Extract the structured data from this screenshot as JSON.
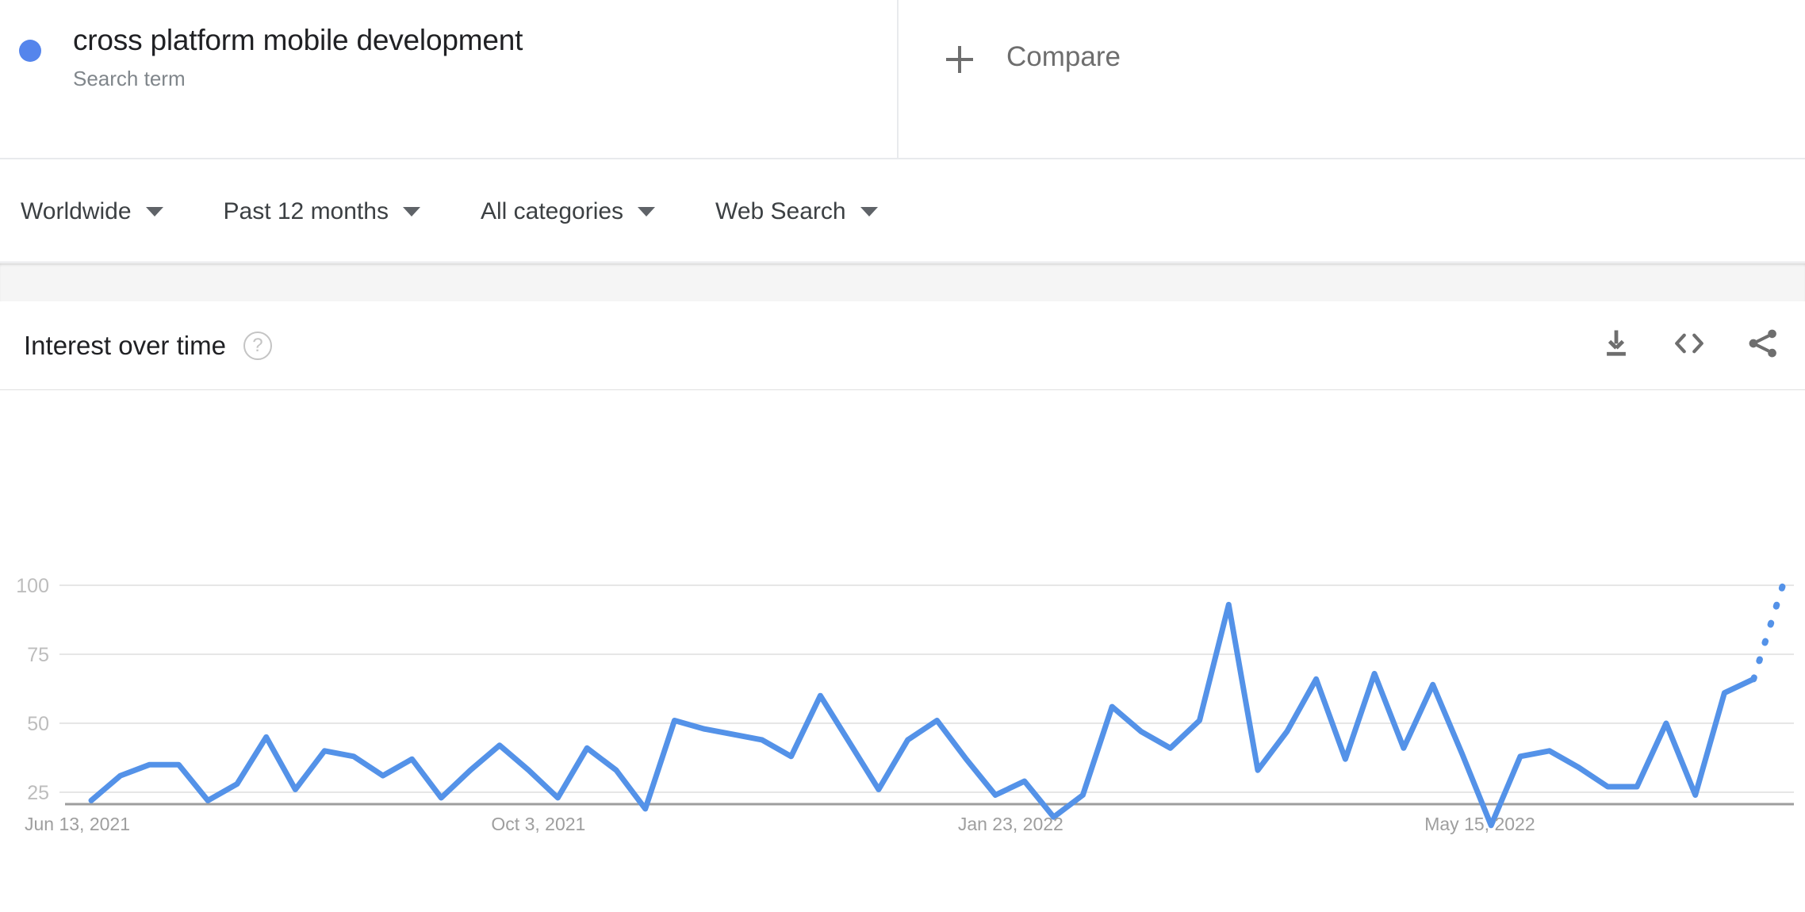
{
  "term": {
    "title": "cross platform mobile development",
    "subtitle": "Search term",
    "dot_color": "#5585ec"
  },
  "compare": {
    "label": "Compare",
    "icon": "plus-icon"
  },
  "filters": [
    {
      "label": "Worldwide",
      "name": "location"
    },
    {
      "label": "Past 12 months",
      "name": "time-range"
    },
    {
      "label": "All categories",
      "name": "category"
    },
    {
      "label": "Web Search",
      "name": "search-type"
    }
  ],
  "card": {
    "title": "Interest over time",
    "help_glyph": "?",
    "actions": [
      {
        "name": "download-csv-icon",
        "label": "Download"
      },
      {
        "name": "embed-code-icon",
        "label": "Embed"
      },
      {
        "name": "share-icon",
        "label": "Share"
      }
    ]
  },
  "chart_data": {
    "type": "line",
    "title": "Interest over time",
    "xlabel": "",
    "ylabel": "",
    "ylim": [
      0,
      100
    ],
    "yticks": [
      25,
      50,
      75,
      100
    ],
    "grid": true,
    "legend": false,
    "line_color": "#5492e8",
    "series_name": "cross platform mobile development",
    "xticks": [
      "Jun 13, 2021",
      "Oct 3, 2021",
      "Jan 23, 2022",
      "May 15, 2022"
    ],
    "xtick_indices": [
      0,
      16,
      32,
      48
    ],
    "partial_last_segment": true,
    "x": [
      "Jun 13, 2021",
      "Jun 20, 2021",
      "Jun 27, 2021",
      "Jul 4, 2021",
      "Jul 11, 2021",
      "Jul 18, 2021",
      "Jul 25, 2021",
      "Aug 1, 2021",
      "Aug 8, 2021",
      "Aug 15, 2021",
      "Aug 22, 2021",
      "Aug 29, 2021",
      "Sep 5, 2021",
      "Sep 12, 2021",
      "Sep 19, 2021",
      "Sep 26, 2021",
      "Oct 3, 2021",
      "Oct 10, 2021",
      "Oct 17, 2021",
      "Oct 24, 2021",
      "Oct 31, 2021",
      "Nov 7, 2021",
      "Nov 14, 2021",
      "Nov 21, 2021",
      "Nov 28, 2021",
      "Dec 5, 2021",
      "Dec 12, 2021",
      "Dec 19, 2021",
      "Dec 26, 2021",
      "Jan 2, 2022",
      "Jan 9, 2022",
      "Jan 16, 2022",
      "Jan 23, 2022",
      "Jan 30, 2022",
      "Feb 6, 2022",
      "Feb 13, 2022",
      "Feb 20, 2022",
      "Feb 27, 2022",
      "Mar 6, 2022",
      "Mar 13, 2022",
      "Mar 20, 2022",
      "Mar 27, 2022",
      "Apr 3, 2022",
      "Apr 10, 2022",
      "Apr 17, 2022",
      "Apr 24, 2022",
      "May 1, 2022",
      "May 8, 2022",
      "May 15, 2022",
      "May 22, 2022",
      "May 29, 2022",
      "Jun 5, 2022",
      "Jun 12, 2022"
    ],
    "values": [
      22,
      31,
      35,
      35,
      22,
      28,
      45,
      26,
      40,
      38,
      31,
      37,
      23,
      33,
      42,
      33,
      23,
      41,
      33,
      19,
      51,
      48,
      46,
      44,
      38,
      60,
      43,
      26,
      44,
      51,
      37,
      24,
      29,
      16,
      24,
      56,
      47,
      41,
      51,
      93,
      33,
      47,
      66,
      37,
      68,
      41,
      64,
      39,
      13,
      38,
      40,
      34,
      27
    ],
    "values_tail": [
      27,
      50,
      24,
      61,
      66,
      100
    ]
  }
}
